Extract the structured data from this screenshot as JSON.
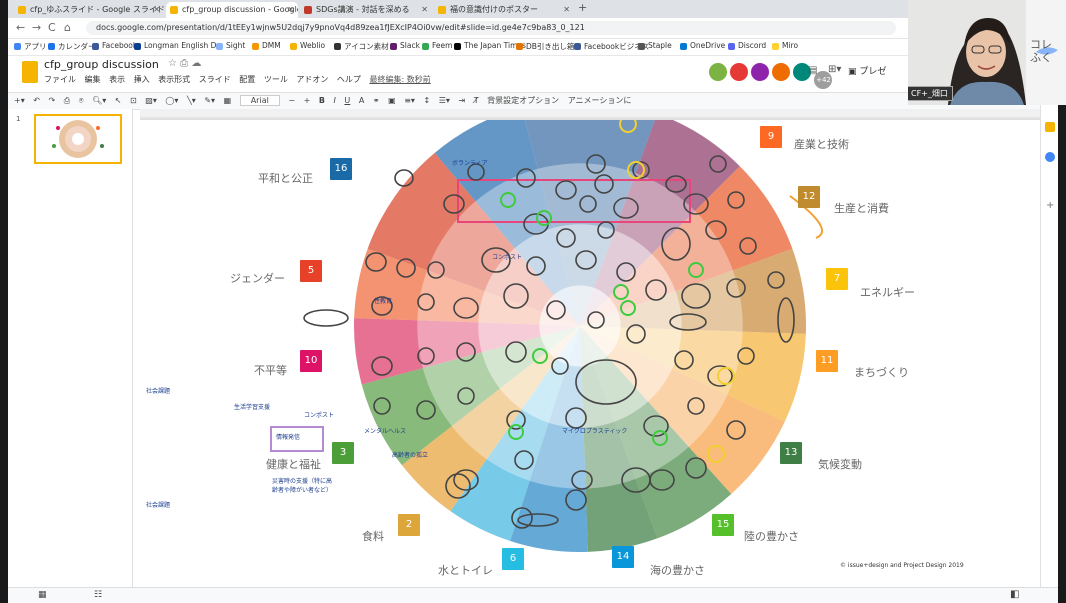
{
  "browser": {
    "tabs": [
      {
        "label": "cfp_ゆふスライド - Google スライド",
        "active": false
      },
      {
        "label": "cfp_group discussion - Google",
        "active": true
      },
      {
        "label": "SDGs講演 - 対話を深める",
        "active": false
      },
      {
        "label": "福の意識付けのポスター",
        "active": false
      }
    ],
    "url": "docs.google.com/presentation/d/1tEEy1wjnw5U2dqj7y9pnoVq4d89zea1fJEXcIP4Oi0vw/edit#slide=id.ge4e7c9ba83_0_121",
    "bookmarks": [
      {
        "label": "アプリ",
        "color": "#4285f4"
      },
      {
        "label": "カレンダー",
        "color": "#1a73e8"
      },
      {
        "label": "Facebook",
        "color": "#3b5998"
      },
      {
        "label": "Longman English D...",
        "color": "#0b3d91"
      },
      {
        "label": "Sight",
        "color": "#8ab4f8"
      },
      {
        "label": "DMM",
        "color": "#f29900"
      },
      {
        "label": "Weblio",
        "color": "#f4b400"
      },
      {
        "label": "アイコン素材",
        "color": "#333333"
      },
      {
        "label": "Slack",
        "color": "#611f69"
      },
      {
        "label": "Feem",
        "color": "#34a853"
      },
      {
        "label": "The Japan Times",
        "color": "#000000"
      },
      {
        "label": "DB引き出し箱",
        "color": "#e37400"
      },
      {
        "label": "Facebookビジネス",
        "color": "#3b5998"
      },
      {
        "label": "Staple",
        "color": "#555555"
      },
      {
        "label": "OneDrive",
        "color": "#0078d4"
      },
      {
        "label": "Discord",
        "color": "#5865f2"
      },
      {
        "label": "Miro",
        "color": "#ffd02f"
      }
    ]
  },
  "slides": {
    "title": "cfp_group discussion",
    "menu": [
      "ファイル",
      "編集",
      "表示",
      "挿入",
      "表示形式",
      "スライド",
      "配置",
      "ツール",
      "アドオン",
      "ヘルプ"
    ],
    "last_edit": "最終編集: 数秒前",
    "present_label": "プレゼ",
    "collaborator_count": "+42",
    "toolbar": {
      "font": "Arial",
      "bg_option": "背景設定オプション",
      "animation": "アニメーションに"
    },
    "slide_number": "1"
  },
  "webcam": {
    "label": "CF+_畑口",
    "overlay_text": [
      "コレ",
      "ふく"
    ]
  },
  "sdg_goals": [
    {
      "name": "平和と公正",
      "num": "16",
      "color": "#1a6aa8"
    },
    {
      "name": "ジェンダー",
      "num": "5",
      "color": "#e8412a"
    },
    {
      "name": "不平等",
      "num": "10",
      "color": "#dd1367"
    },
    {
      "name": "健康と福祉",
      "num": "3",
      "color": "#4c9f38"
    },
    {
      "name": "食料",
      "num": "2",
      "color": "#dda63a"
    },
    {
      "name": "水とトイレ",
      "num": "6",
      "color": "#26bde2"
    },
    {
      "name": "海の豊かさ",
      "num": "14",
      "color": "#0a97d9"
    },
    {
      "name": "陸の豊かさ",
      "num": "15",
      "color": "#56c02b"
    },
    {
      "name": "気候変動",
      "num": "13",
      "color": "#3f7e44"
    },
    {
      "name": "まちづくり",
      "num": "11",
      "color": "#fd9d24"
    },
    {
      "name": "エネルギー",
      "num": "7",
      "color": "#fcc30b"
    },
    {
      "name": "生産と消費",
      "num": "12",
      "color": "#bf8b2e"
    },
    {
      "name": "産業と技術",
      "num": "9",
      "color": "#fd6925"
    }
  ],
  "annotations": {
    "social_issue_1": "社会課題",
    "social_issue_2": "社会課題",
    "support": "生活学習支援",
    "compost_1": "コンポスト",
    "compost_2": "コンポスト",
    "info_box": "情報発信",
    "mental": "メンタルヘルス",
    "elderly": "高齢者の孤立",
    "disaster_note": "災害時の支援（特に高齢者や障がい者など）",
    "microplastic": "マイクロプラスティック",
    "gender_note": "性教育",
    "volunteer": "ボランティア",
    "copyright": "© issue+design and Project Design 2019"
  }
}
